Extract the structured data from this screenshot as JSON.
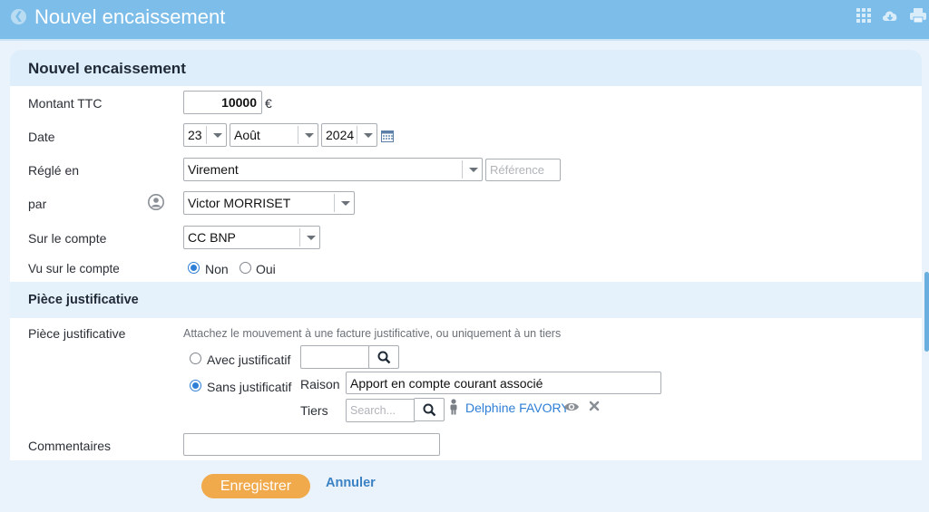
{
  "topbar": {
    "title": "Nouvel encaissement",
    "icons": [
      "back-icon",
      "apps-grid-icon",
      "cloud-download-icon",
      "print-icon"
    ]
  },
  "form": {
    "title": "Nouvel encaissement",
    "montant": {
      "label": "Montant TTC",
      "value": "10000",
      "currency": "€"
    },
    "date": {
      "label": "Date",
      "day": "23",
      "month": "Août",
      "year": "2024"
    },
    "regle_en": {
      "label": "Réglé en",
      "value": "Virement",
      "reference_placeholder": "Référence"
    },
    "par": {
      "label": "par",
      "value": "Victor MORRISET"
    },
    "compte": {
      "label": "Sur le compte",
      "value": "CC BNP"
    },
    "vu": {
      "label": "Vu sur le compte",
      "options": [
        "Non",
        "Oui"
      ],
      "selected": "Non"
    }
  },
  "piece": {
    "section_title": "Pièce justificative",
    "label": "Pièce justificative",
    "hint": "Attachez le mouvement à une facture justificative, ou uniquement à un tiers",
    "avec_label": "Avec justificatif",
    "sans_label": "Sans justificatif",
    "selected": "Sans justificatif",
    "raison_label": "Raison",
    "raison_value": "Apport en compte courant associé",
    "tiers_label": "Tiers",
    "tiers_search_placeholder": "Search...",
    "tiers_name": "Delphine FAVORY"
  },
  "commentaires": {
    "label": "Commentaires",
    "value": ""
  },
  "actions": {
    "save_label": "Enregistrer",
    "cancel_label": "Annuler"
  },
  "colors": {
    "topbar": "#7cbde9",
    "accent": "#2f7fd6",
    "save": "#f0a94b",
    "link": "#3b82c4"
  }
}
